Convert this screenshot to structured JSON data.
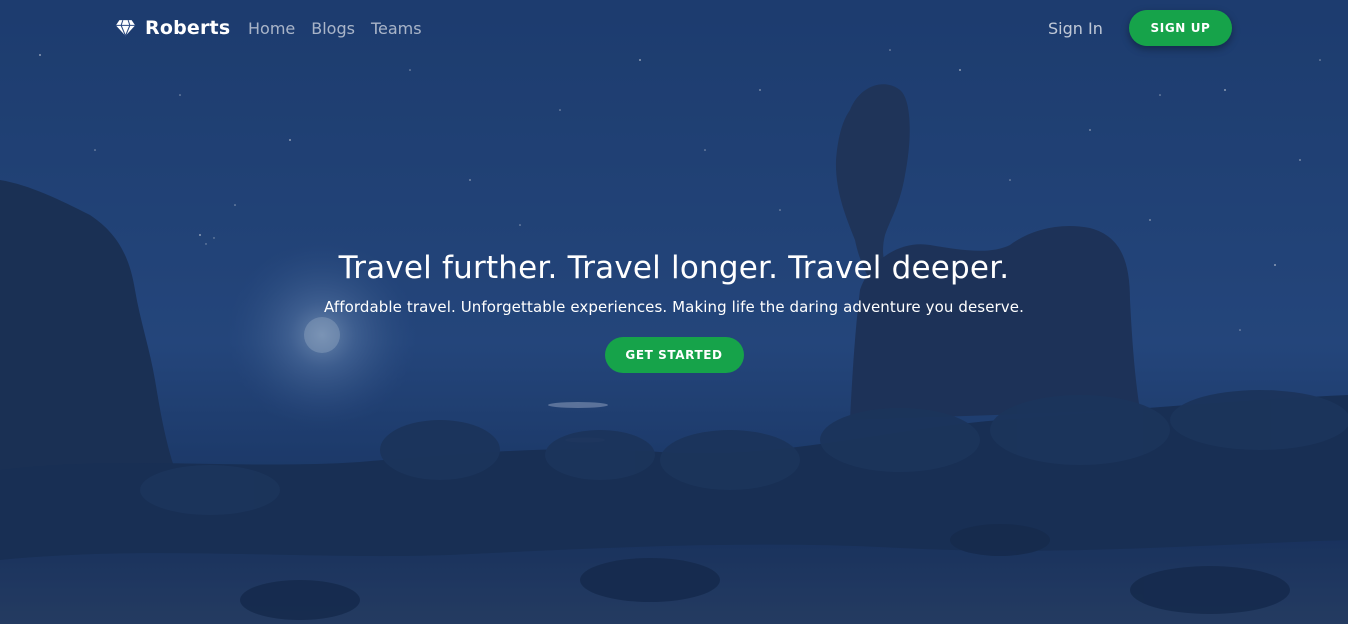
{
  "nav": {
    "brand": "Roberts",
    "brand_icon": "diamond-icon",
    "links": [
      {
        "label": "Home"
      },
      {
        "label": "Blogs"
      },
      {
        "label": "Teams"
      }
    ],
    "signin_label": "Sign In",
    "signup_label": "SIGN UP"
  },
  "hero": {
    "headline": "Travel further. Travel longer. Travel deeper.",
    "subline": "Affordable travel. Unforgettable experiences. Making life the daring adventure you deserve.",
    "cta_label": "GET STARTED"
  },
  "colors": {
    "accent": "#16a34a",
    "overlay": "#1b3668",
    "text": "#ffffff"
  }
}
